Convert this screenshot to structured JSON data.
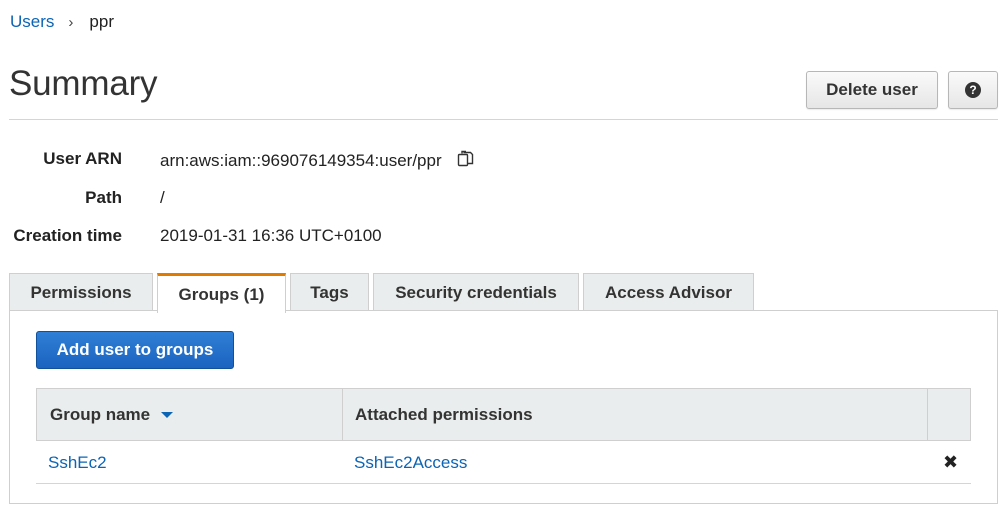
{
  "breadcrumb": {
    "parent": "Users",
    "separator": "›",
    "current": "ppr"
  },
  "header": {
    "title": "Summary",
    "delete_label": "Delete user",
    "help_glyph": "?"
  },
  "details": [
    {
      "label": "User ARN",
      "value": "arn:aws:iam::969076149354:user/ppr"
    },
    {
      "label": "Path",
      "value": "/"
    },
    {
      "label": "Creation time",
      "value": "2019-01-31 16:36 UTC+0100"
    }
  ],
  "tabs": [
    {
      "label": "Permissions",
      "active": false
    },
    {
      "label": "Groups (1)",
      "active": true
    },
    {
      "label": "Tags",
      "active": false
    },
    {
      "label": "Security credentials",
      "active": false
    },
    {
      "label": "Access Advisor",
      "active": false
    }
  ],
  "groups_panel": {
    "add_button": "Add user to groups",
    "columns": [
      "Group name",
      "Attached permissions"
    ],
    "rows": [
      {
        "group": "SshEc2",
        "permissions": "SshEc2Access"
      }
    ],
    "remove_glyph": "✖"
  },
  "colors": {
    "accent_tab": "#e07b00",
    "link": "#0b64b4",
    "primary": "#1b63bf"
  },
  "icons": [
    "chevron-right-icon",
    "help-icon",
    "copy-icon",
    "sort-down-icon",
    "remove-icon"
  ]
}
